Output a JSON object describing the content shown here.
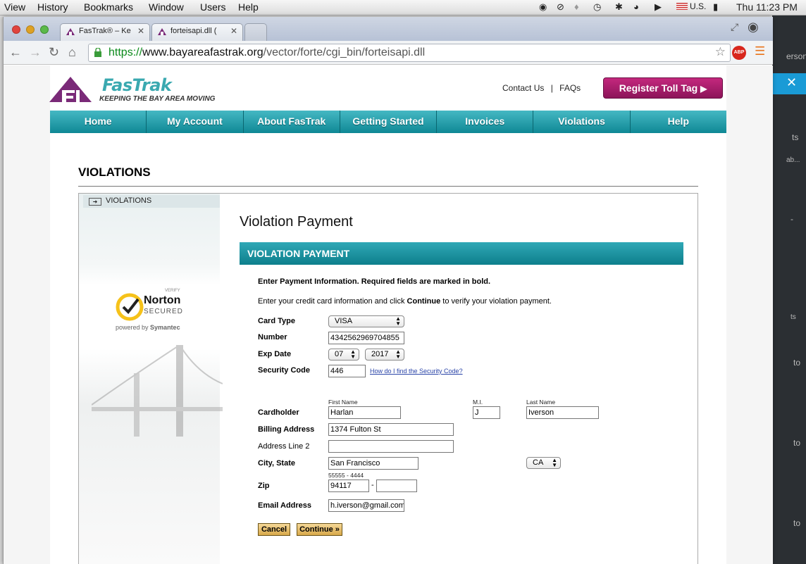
{
  "menubar": {
    "items": [
      "View",
      "History",
      "Bookmarks",
      "Window",
      "Users",
      "Help"
    ],
    "locale": "U.S.",
    "clock": "Thu 11:23 PM"
  },
  "browser": {
    "tabs": [
      {
        "title": "FasTrak® – Ke",
        "active": true
      },
      {
        "title": "forteisapi.dll (",
        "active": true
      }
    ],
    "url_scheme": "https://",
    "url_host": "www.bayareafastrak.org",
    "url_path": "/vector/forte/cgi_bin/forteisapi.dll",
    "abp_label": "ABP"
  },
  "background_window": {
    "texts": [
      "erson",
      "ts",
      "ab...",
      "-",
      "ts",
      "to",
      "to",
      "to"
    ]
  },
  "site": {
    "logo_name": "FasTrak",
    "logo_mark_text": "FasTrak",
    "tagline": "KEEPING THE BAY AREA MOVING",
    "contact_label": "Contact Us",
    "faqs_label": "FAQs",
    "register_label": "Register Toll Tag",
    "nav": [
      "Home",
      "My Account",
      "About FasTrak",
      "Getting Started",
      "Invoices",
      "Violations",
      "Help"
    ],
    "page_heading": "VIOLATIONS",
    "sidebar_heading": "VIOLATIONS",
    "norton": {
      "verify": "VERIFY",
      "brand": "Norton",
      "secured": "SECURED",
      "powered_prefix": "powered by",
      "powered_brand": "Symantec"
    }
  },
  "form": {
    "title": "Violation Payment",
    "bar": "VIOLATION PAYMENT",
    "intro_bold": "Enter Payment Information. Required fields are marked in bold.",
    "intro2_pre": "Enter your credit card information and click ",
    "intro2_bold": "Continue",
    "intro2_post": " to verify your violation payment.",
    "labels": {
      "card_type": "Card Type",
      "number": "Number",
      "exp_date": "Exp Date",
      "security_code": "Security Code",
      "cardholder": "Cardholder",
      "billing": "Billing Address",
      "address2": "Address Line 2",
      "city_state": "City, State",
      "zip": "Zip",
      "email": "Email Address",
      "first_name": "First Name",
      "mi": "M.I.",
      "last_name": "Last Name",
      "zip_hint": "55555 - 4444"
    },
    "values": {
      "card_type": "VISA",
      "number": "4342562969704855",
      "exp_month": "07",
      "exp_year": "2017",
      "security_code": "446",
      "first_name": "Harlan",
      "mi": "J",
      "last_name": "Iverson",
      "billing": "1374 Fulton St",
      "address2": "",
      "city": "San Francisco",
      "state": "CA",
      "zip": "94117",
      "zip4": "",
      "email": "h.iverson@gmail.com"
    },
    "security_link": "How do I find the Security Code?",
    "zip_dash": "-",
    "cancel_label": "Cancel",
    "continue_label": "Continue »"
  }
}
